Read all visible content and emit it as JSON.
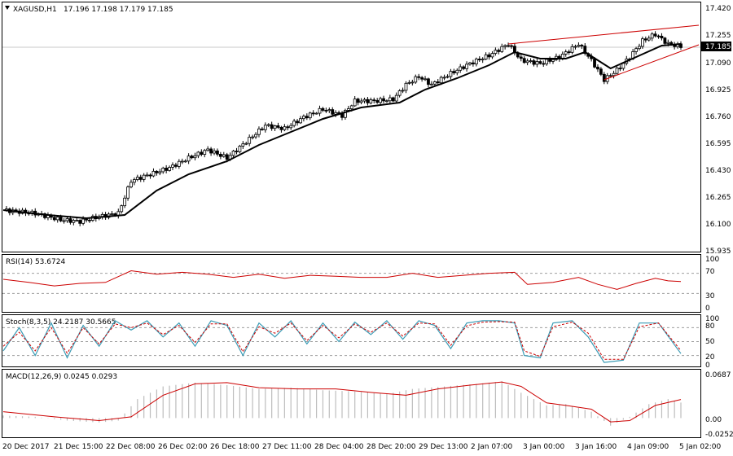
{
  "chart_data": [
    {
      "type": "candlestick",
      "title": "XAGUSD,H1",
      "ohlc_text": "17.196 17.198 17.179 17.185",
      "last_price": "17.185",
      "y_ticks": [
        "17.420",
        "17.255",
        "17.090",
        "16.925",
        "16.760",
        "16.595",
        "16.430",
        "16.265",
        "16.100",
        "15.935"
      ],
      "ylim": [
        15.935,
        17.42
      ],
      "x_labels": [
        "20 Dec 2017",
        "21 Dec 15:00",
        "22 Dec 08:00",
        "26 Dec 02:00",
        "26 Dec 18:00",
        "27 Dec 11:00",
        "28 Dec 04:00",
        "28 Dec 20:00",
        "29 Dec 13:00",
        "2 Jan 07:00",
        "3 Jan 00:00",
        "3 Jan 16:00",
        "4 Jan 09:00",
        "5 Jan 02:00"
      ],
      "close_series": [
        {
          "i": 0,
          "v": 16.18
        },
        {
          "i": 10,
          "v": 16.16
        },
        {
          "i": 18,
          "v": 16.12
        },
        {
          "i": 24,
          "v": 16.11
        },
        {
          "i": 30,
          "v": 16.14
        },
        {
          "i": 36,
          "v": 16.16
        },
        {
          "i": 40,
          "v": 16.36
        },
        {
          "i": 46,
          "v": 16.4
        },
        {
          "i": 52,
          "v": 16.44
        },
        {
          "i": 58,
          "v": 16.5
        },
        {
          "i": 64,
          "v": 16.55
        },
        {
          "i": 70,
          "v": 16.5
        },
        {
          "i": 76,
          "v": 16.6
        },
        {
          "i": 82,
          "v": 16.7
        },
        {
          "i": 88,
          "v": 16.68
        },
        {
          "i": 94,
          "v": 16.75
        },
        {
          "i": 100,
          "v": 16.8
        },
        {
          "i": 106,
          "v": 16.76
        },
        {
          "i": 110,
          "v": 16.85
        },
        {
          "i": 116,
          "v": 16.85
        },
        {
          "i": 122,
          "v": 16.86
        },
        {
          "i": 126,
          "v": 16.95
        },
        {
          "i": 130,
          "v": 17.0
        },
        {
          "i": 134,
          "v": 16.95
        },
        {
          "i": 140,
          "v": 17.02
        },
        {
          "i": 146,
          "v": 17.08
        },
        {
          "i": 152,
          "v": 17.13
        },
        {
          "i": 158,
          "v": 17.2
        },
        {
          "i": 162,
          "v": 17.1
        },
        {
          "i": 168,
          "v": 17.08
        },
        {
          "i": 174,
          "v": 17.12
        },
        {
          "i": 180,
          "v": 17.2
        },
        {
          "i": 184,
          "v": 17.1
        },
        {
          "i": 188,
          "v": 16.98
        },
        {
          "i": 192,
          "v": 17.04
        },
        {
          "i": 196,
          "v": 17.12
        },
        {
          "i": 200,
          "v": 17.22
        },
        {
          "i": 204,
          "v": 17.26
        },
        {
          "i": 208,
          "v": 17.2
        },
        {
          "i": 212,
          "v": 17.185
        }
      ],
      "ma_series": [
        {
          "i": 0,
          "v": 16.18
        },
        {
          "i": 14,
          "v": 16.15
        },
        {
          "i": 26,
          "v": 16.13
        },
        {
          "i": 38,
          "v": 16.15
        },
        {
          "i": 48,
          "v": 16.3
        },
        {
          "i": 58,
          "v": 16.4
        },
        {
          "i": 70,
          "v": 16.48
        },
        {
          "i": 80,
          "v": 16.58
        },
        {
          "i": 90,
          "v": 16.66
        },
        {
          "i": 100,
          "v": 16.74
        },
        {
          "i": 112,
          "v": 16.81
        },
        {
          "i": 124,
          "v": 16.84
        },
        {
          "i": 132,
          "v": 16.92
        },
        {
          "i": 142,
          "v": 16.99
        },
        {
          "i": 152,
          "v": 17.07
        },
        {
          "i": 160,
          "v": 17.15
        },
        {
          "i": 168,
          "v": 17.11
        },
        {
          "i": 176,
          "v": 17.11
        },
        {
          "i": 182,
          "v": 17.15
        },
        {
          "i": 190,
          "v": 17.05
        },
        {
          "i": 198,
          "v": 17.12
        },
        {
          "i": 206,
          "v": 17.19
        },
        {
          "i": 212,
          "v": 17.2
        }
      ],
      "trendlines": [
        {
          "from": {
            "i": 158,
            "v": 17.2
          },
          "to": {
            "i": 212,
            "v": 17.3
          }
        },
        {
          "from": {
            "i": 188,
            "v": 16.98
          },
          "to": {
            "i": 212,
            "v": 17.18
          }
        }
      ]
    },
    {
      "type": "line",
      "title": "RSI(14) 53.6724",
      "y_ticks": [
        "100",
        "70",
        "30",
        "0"
      ],
      "ylim": [
        0,
        100
      ],
      "levels": [
        70,
        30
      ],
      "series": [
        {
          "i": 0,
          "v": 58
        },
        {
          "i": 8,
          "v": 52
        },
        {
          "i": 16,
          "v": 45
        },
        {
          "i": 24,
          "v": 50
        },
        {
          "i": 32,
          "v": 52
        },
        {
          "i": 40,
          "v": 75
        },
        {
          "i": 48,
          "v": 68
        },
        {
          "i": 56,
          "v": 72
        },
        {
          "i": 64,
          "v": 68
        },
        {
          "i": 72,
          "v": 62
        },
        {
          "i": 80,
          "v": 68
        },
        {
          "i": 88,
          "v": 60
        },
        {
          "i": 96,
          "v": 66
        },
        {
          "i": 104,
          "v": 64
        },
        {
          "i": 112,
          "v": 62
        },
        {
          "i": 120,
          "v": 62
        },
        {
          "i": 128,
          "v": 70
        },
        {
          "i": 136,
          "v": 62
        },
        {
          "i": 144,
          "v": 66
        },
        {
          "i": 152,
          "v": 70
        },
        {
          "i": 160,
          "v": 72
        },
        {
          "i": 164,
          "v": 48
        },
        {
          "i": 172,
          "v": 52
        },
        {
          "i": 180,
          "v": 62
        },
        {
          "i": 186,
          "v": 48
        },
        {
          "i": 192,
          "v": 38
        },
        {
          "i": 198,
          "v": 50
        },
        {
          "i": 204,
          "v": 60
        },
        {
          "i": 208,
          "v": 55
        },
        {
          "i": 212,
          "v": 53.67
        }
      ]
    },
    {
      "type": "line",
      "title": "Stoch(8,3,5) 24.2187 30.5665",
      "y_ticks": [
        "100",
        "80",
        "50",
        "20",
        "0"
      ],
      "ylim": [
        0,
        100
      ],
      "levels": [
        80,
        50,
        20
      ],
      "series": [
        {
          "name": "main",
          "color": "#3a9bb5",
          "points": [
            {
              "i": 0,
              "v": 30
            },
            {
              "i": 5,
              "v": 80
            },
            {
              "i": 10,
              "v": 20
            },
            {
              "i": 15,
              "v": 90
            },
            {
              "i": 20,
              "v": 15
            },
            {
              "i": 25,
              "v": 85
            },
            {
              "i": 30,
              "v": 40
            },
            {
              "i": 35,
              "v": 95
            },
            {
              "i": 40,
              "v": 75
            },
            {
              "i": 45,
              "v": 95
            },
            {
              "i": 50,
              "v": 60
            },
            {
              "i": 55,
              "v": 90
            },
            {
              "i": 60,
              "v": 40
            },
            {
              "i": 65,
              "v": 95
            },
            {
              "i": 70,
              "v": 85
            },
            {
              "i": 75,
              "v": 20
            },
            {
              "i": 80,
              "v": 90
            },
            {
              "i": 85,
              "v": 60
            },
            {
              "i": 90,
              "v": 95
            },
            {
              "i": 95,
              "v": 45
            },
            {
              "i": 100,
              "v": 90
            },
            {
              "i": 105,
              "v": 50
            },
            {
              "i": 110,
              "v": 92
            },
            {
              "i": 115,
              "v": 65
            },
            {
              "i": 120,
              "v": 95
            },
            {
              "i": 125,
              "v": 55
            },
            {
              "i": 130,
              "v": 95
            },
            {
              "i": 135,
              "v": 85
            },
            {
              "i": 140,
              "v": 35
            },
            {
              "i": 145,
              "v": 90
            },
            {
              "i": 150,
              "v": 95
            },
            {
              "i": 155,
              "v": 95
            },
            {
              "i": 160,
              "v": 90
            },
            {
              "i": 163,
              "v": 20
            },
            {
              "i": 168,
              "v": 15
            },
            {
              "i": 172,
              "v": 90
            },
            {
              "i": 178,
              "v": 95
            },
            {
              "i": 183,
              "v": 60
            },
            {
              "i": 188,
              "v": 5
            },
            {
              "i": 194,
              "v": 10
            },
            {
              "i": 199,
              "v": 90
            },
            {
              "i": 205,
              "v": 90
            },
            {
              "i": 212,
              "v": 24.22
            }
          ]
        },
        {
          "name": "signal",
          "color": "#cc0000",
          "points": [
            {
              "i": 0,
              "v": 40
            },
            {
              "i": 5,
              "v": 70
            },
            {
              "i": 10,
              "v": 30
            },
            {
              "i": 15,
              "v": 80
            },
            {
              "i": 20,
              "v": 25
            },
            {
              "i": 25,
              "v": 80
            },
            {
              "i": 30,
              "v": 45
            },
            {
              "i": 35,
              "v": 88
            },
            {
              "i": 40,
              "v": 80
            },
            {
              "i": 45,
              "v": 90
            },
            {
              "i": 50,
              "v": 65
            },
            {
              "i": 55,
              "v": 85
            },
            {
              "i": 60,
              "v": 48
            },
            {
              "i": 65,
              "v": 88
            },
            {
              "i": 70,
              "v": 88
            },
            {
              "i": 75,
              "v": 28
            },
            {
              "i": 80,
              "v": 82
            },
            {
              "i": 85,
              "v": 68
            },
            {
              "i": 90,
              "v": 90
            },
            {
              "i": 95,
              "v": 52
            },
            {
              "i": 100,
              "v": 85
            },
            {
              "i": 105,
              "v": 58
            },
            {
              "i": 110,
              "v": 88
            },
            {
              "i": 115,
              "v": 70
            },
            {
              "i": 120,
              "v": 90
            },
            {
              "i": 125,
              "v": 62
            },
            {
              "i": 130,
              "v": 90
            },
            {
              "i": 135,
              "v": 88
            },
            {
              "i": 140,
              "v": 42
            },
            {
              "i": 145,
              "v": 84
            },
            {
              "i": 150,
              "v": 92
            },
            {
              "i": 155,
              "v": 93
            },
            {
              "i": 160,
              "v": 92
            },
            {
              "i": 163,
              "v": 30
            },
            {
              "i": 168,
              "v": 18
            },
            {
              "i": 172,
              "v": 82
            },
            {
              "i": 178,
              "v": 92
            },
            {
              "i": 183,
              "v": 68
            },
            {
              "i": 188,
              "v": 12
            },
            {
              "i": 194,
              "v": 12
            },
            {
              "i": 199,
              "v": 82
            },
            {
              "i": 205,
              "v": 90
            },
            {
              "i": 212,
              "v": 30.57
            }
          ]
        }
      ]
    },
    {
      "type": "bar",
      "title": "MACD(12,26,9) 0.0245 0.0293",
      "y_ticks": [
        "0.0687",
        "0.00",
        "-0.0252"
      ],
      "ylim": [
        -0.0252,
        0.0687
      ],
      "histogram": [
        {
          "i": 0,
          "v": 0.004
        },
        {
          "i": 10,
          "v": 0.002
        },
        {
          "i": 20,
          "v": -0.004
        },
        {
          "i": 30,
          "v": -0.007
        },
        {
          "i": 36,
          "v": -0.004
        },
        {
          "i": 42,
          "v": 0.03
        },
        {
          "i": 50,
          "v": 0.05
        },
        {
          "i": 60,
          "v": 0.056
        },
        {
          "i": 70,
          "v": 0.052
        },
        {
          "i": 80,
          "v": 0.046
        },
        {
          "i": 90,
          "v": 0.048
        },
        {
          "i": 100,
          "v": 0.044
        },
        {
          "i": 110,
          "v": 0.042
        },
        {
          "i": 120,
          "v": 0.038
        },
        {
          "i": 128,
          "v": 0.046
        },
        {
          "i": 138,
          "v": 0.05
        },
        {
          "i": 148,
          "v": 0.054
        },
        {
          "i": 156,
          "v": 0.058
        },
        {
          "i": 162,
          "v": 0.04
        },
        {
          "i": 170,
          "v": 0.02
        },
        {
          "i": 176,
          "v": 0.022
        },
        {
          "i": 184,
          "v": 0.01
        },
        {
          "i": 190,
          "v": -0.012
        },
        {
          "i": 196,
          "v": 0.002
        },
        {
          "i": 202,
          "v": 0.022
        },
        {
          "i": 208,
          "v": 0.03
        },
        {
          "i": 212,
          "v": 0.0245
        }
      ],
      "signal": [
        {
          "i": 0,
          "v": 0.01
        },
        {
          "i": 16,
          "v": 0.002
        },
        {
          "i": 30,
          "v": -0.004
        },
        {
          "i": 40,
          "v": 0.002
        },
        {
          "i": 50,
          "v": 0.036
        },
        {
          "i": 60,
          "v": 0.054
        },
        {
          "i": 70,
          "v": 0.056
        },
        {
          "i": 80,
          "v": 0.048
        },
        {
          "i": 92,
          "v": 0.046
        },
        {
          "i": 104,
          "v": 0.046
        },
        {
          "i": 116,
          "v": 0.04
        },
        {
          "i": 126,
          "v": 0.036
        },
        {
          "i": 136,
          "v": 0.046
        },
        {
          "i": 146,
          "v": 0.052
        },
        {
          "i": 156,
          "v": 0.057
        },
        {
          "i": 162,
          "v": 0.05
        },
        {
          "i": 170,
          "v": 0.024
        },
        {
          "i": 176,
          "v": 0.02
        },
        {
          "i": 184,
          "v": 0.014
        },
        {
          "i": 190,
          "v": -0.006
        },
        {
          "i": 196,
          "v": -0.004
        },
        {
          "i": 204,
          "v": 0.02
        },
        {
          "i": 212,
          "v": 0.0293
        }
      ]
    }
  ],
  "colors": {
    "price_line": "#000000",
    "trend": "#cc0000",
    "rsi": "#cc0000",
    "macd_hist": "#bdbdbd",
    "macd_signal": "#cc0000",
    "last_price_bg": "#000000",
    "last_price_fg": "#ffffff",
    "level_line": "#9e9e9e"
  }
}
